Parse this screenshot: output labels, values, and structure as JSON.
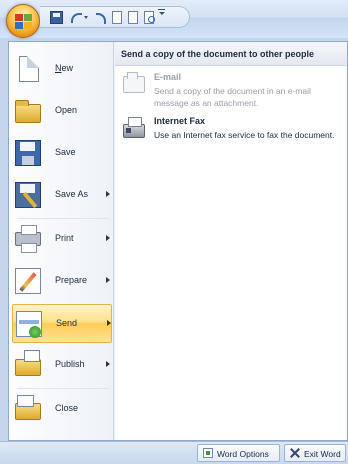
{
  "menu": {
    "items": [
      {
        "key": "N",
        "label": "New",
        "icon": "new-document-icon",
        "submenu": false
      },
      {
        "key": "O",
        "label": "Open",
        "icon": "open-folder-icon",
        "submenu": false
      },
      {
        "key": "S",
        "label": "Save",
        "icon": "save-icon",
        "submenu": false
      },
      {
        "label": "Save As",
        "icon": "save-as-icon",
        "submenu": true
      },
      {
        "key": "P",
        "label": "Print",
        "icon": "printer-icon",
        "submenu": true
      },
      {
        "label": "Prepare",
        "icon": "prepare-icon",
        "submenu": true
      },
      {
        "label": "Send",
        "icon": "send-icon",
        "submenu": true,
        "active": true
      },
      {
        "label": "Publish",
        "icon": "publish-icon",
        "submenu": true
      },
      {
        "key": "C",
        "label": "Close",
        "icon": "close-folder-icon",
        "submenu": false
      }
    ]
  },
  "send_panel": {
    "title": "Send a copy of the document to other people",
    "options": [
      {
        "title": "E-mail",
        "description": "Send a copy of the document in an e-mail message as an attachment.",
        "enabled": false,
        "icon": "email-icon"
      },
      {
        "title": "Internet Fax",
        "description": "Use an Internet fax service to fax the document.",
        "enabled": true,
        "icon": "fax-icon"
      }
    ]
  },
  "footer": {
    "options_label": "Word Options",
    "exit_label": "Exit Word"
  },
  "colors": {
    "active_highlight": "#ffd56b",
    "panel_header": "#e4e9f1",
    "border": "#8ea9ce"
  }
}
